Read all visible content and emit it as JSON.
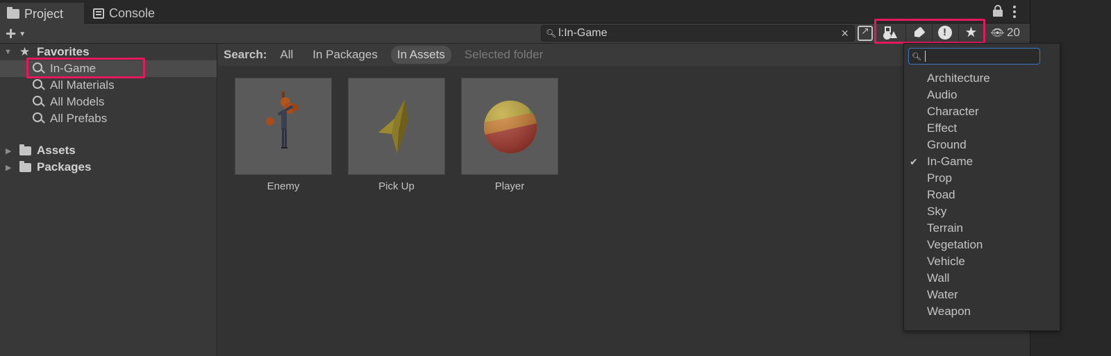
{
  "tabs": [
    {
      "label": "Project",
      "icon": "folder-icon",
      "active": true
    },
    {
      "label": "Console",
      "icon": "console-icon",
      "active": false
    }
  ],
  "toolbar": {
    "search_value": "l:In-Game",
    "hidden_count": "20"
  },
  "sidebar": {
    "favorites_label": "Favorites",
    "favorites": [
      "In-Game",
      "All Materials",
      "All Models",
      "All Prefabs"
    ],
    "roots": [
      "Assets",
      "Packages"
    ]
  },
  "search_scope": {
    "label": "Search:",
    "options": [
      "All",
      "In Packages",
      "In Assets",
      "Selected folder"
    ],
    "active": "In Assets"
  },
  "assets": [
    {
      "name": "Enemy"
    },
    {
      "name": "Pick Up"
    },
    {
      "name": "Player"
    }
  ],
  "label_dropdown": {
    "search_value": "",
    "items": [
      "Architecture",
      "Audio",
      "Character",
      "Effect",
      "Ground",
      "In-Game",
      "Prop",
      "Road",
      "Sky",
      "Terrain",
      "Vegetation",
      "Vehicle",
      "Wall",
      "Water",
      "Weapon"
    ],
    "checked": "In-Game"
  },
  "colors": {
    "highlight": "#e4195d",
    "focus_border": "#3d78c7"
  }
}
